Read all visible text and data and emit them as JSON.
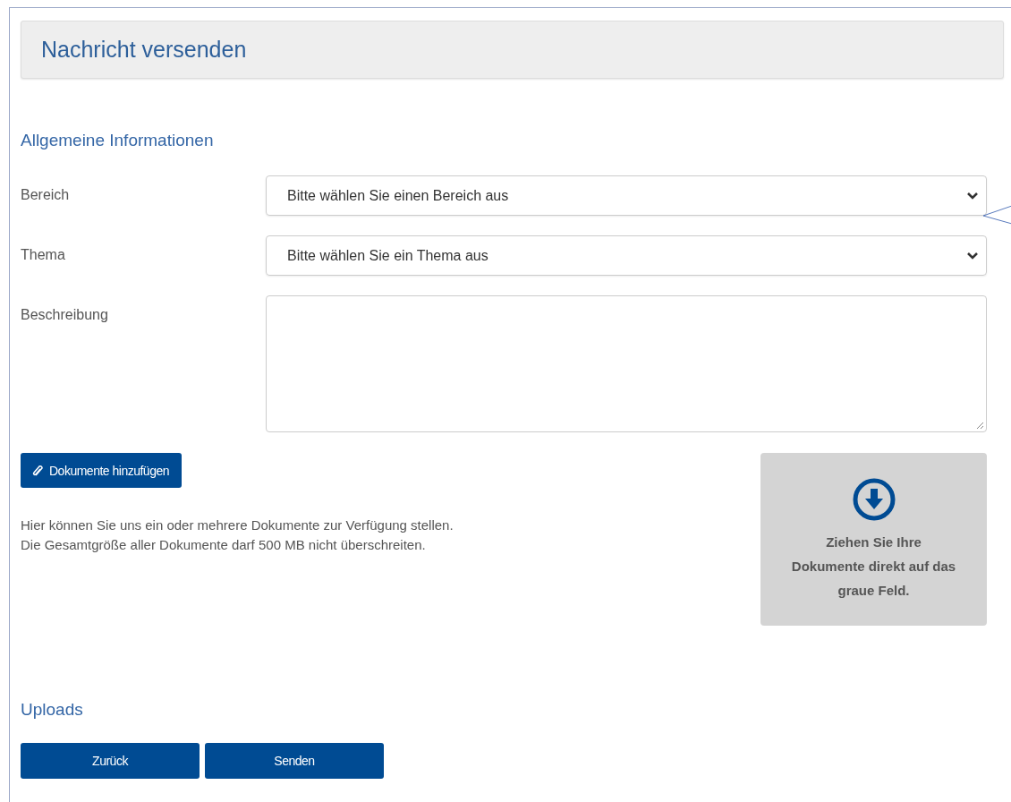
{
  "header": {
    "title": "Nachricht versenden"
  },
  "section": {
    "title": "Allgemeine Informationen"
  },
  "fields": [
    {
      "kind": "select",
      "label": "Bereich",
      "placeholder": "Bitte wählen Sie einen Bereich aus"
    },
    {
      "kind": "select",
      "label": "Thema",
      "placeholder": "Bitte wählen Sie ein Thema aus"
    },
    {
      "kind": "textarea",
      "label": "Beschreibung"
    }
  ],
  "attach_button": {
    "label": "Dokumente hinzufügen"
  },
  "info_lines": [
    "Hier können Sie uns ein oder mehrere Dokumente zur Verfügung stellen.",
    "Die Gesamtgröße aller Dokumente darf 500 MB nicht überschreiten."
  ],
  "drop_zone": {
    "text": "Ziehen Sie Ihre Dokumente direkt auf das graue Feld."
  },
  "uploads": {
    "title": "Uploads"
  },
  "buttons": [
    "Zurück",
    "Senden"
  ]
}
